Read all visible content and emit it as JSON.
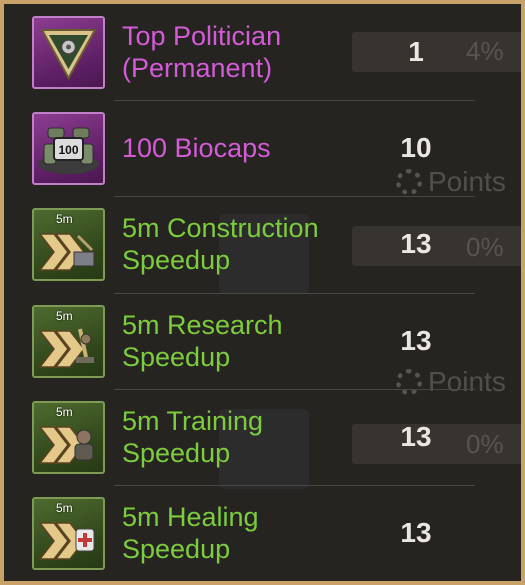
{
  "background_text": {
    "percent_a": "4%",
    "percent_b": "0%",
    "percent_c": "0%",
    "points_a": "Points",
    "points_b": "Points"
  },
  "rewards": [
    {
      "name_line1": "Top Politician",
      "name_line2": "(Permanent)",
      "quantity": "1",
      "rarity": "purple",
      "icon": "triangle-badge-icon",
      "icon_tag": ""
    },
    {
      "name_line1": "100 Biocaps",
      "name_line2": "",
      "quantity": "10",
      "rarity": "purple",
      "icon": "biocaps-pile-icon",
      "icon_tag": "100"
    },
    {
      "name_line1": "5m Construction",
      "name_line2": "Speedup",
      "quantity": "13",
      "rarity": "green",
      "icon": "construction-speedup-icon",
      "icon_tag": "5m"
    },
    {
      "name_line1": "5m Research",
      "name_line2": "Speedup",
      "quantity": "13",
      "rarity": "green",
      "icon": "research-speedup-icon",
      "icon_tag": "5m"
    },
    {
      "name_line1": "5m Training",
      "name_line2": "Speedup",
      "quantity": "13",
      "rarity": "green",
      "icon": "training-speedup-icon",
      "icon_tag": "5m"
    },
    {
      "name_line1": "5m Healing",
      "name_line2": "Speedup",
      "quantity": "13",
      "rarity": "green",
      "icon": "healing-speedup-icon",
      "icon_tag": "5m"
    }
  ],
  "colors": {
    "frame": "#c9a26a",
    "panel": "#262421",
    "purple_text": "#d35bd6",
    "green_text": "#7ccc3c",
    "quantity_text": "#ebe6df"
  }
}
